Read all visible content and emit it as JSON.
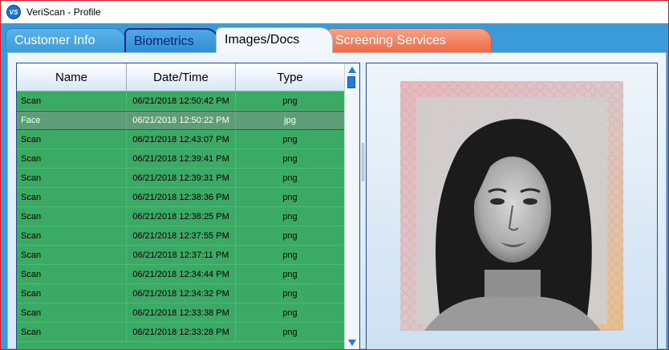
{
  "window": {
    "title": "VeriScan - Profile",
    "icon_text": "VS",
    "accent_border": "#e81123"
  },
  "tabs": [
    {
      "label": "Customer Info",
      "color": "#5ab2ea"
    },
    {
      "label": "Biometrics",
      "color": "#2f8fd3"
    },
    {
      "label": "Images/Docs",
      "color": "#f4f8fc",
      "selected": true
    },
    {
      "label": "Screening Services",
      "color": "#ee6a45"
    }
  ],
  "grid": {
    "columns": [
      "Name",
      "Date/Time",
      "Type"
    ],
    "row_color": "#3aaa64",
    "selected_index": 1,
    "rows": [
      {
        "name": "Scan",
        "datetime": "06/21/2018 12:50:42 PM",
        "type": "png"
      },
      {
        "name": "Face",
        "datetime": "06/21/2018 12:50:22 PM",
        "type": "jpg"
      },
      {
        "name": "Scan",
        "datetime": "06/21/2018 12:43:07 PM",
        "type": "png"
      },
      {
        "name": "Scan",
        "datetime": "06/21/2018 12:39:41 PM",
        "type": "png"
      },
      {
        "name": "Scan",
        "datetime": "06/21/2018 12:39:31 PM",
        "type": "png"
      },
      {
        "name": "Scan",
        "datetime": "06/21/2018 12:38:36 PM",
        "type": "png"
      },
      {
        "name": "Scan",
        "datetime": "06/21/2018 12:38:25 PM",
        "type": "png"
      },
      {
        "name": "Scan",
        "datetime": "06/21/2018 12:37:55 PM",
        "type": "png"
      },
      {
        "name": "Scan",
        "datetime": "06/21/2018 12:37:11 PM",
        "type": "png"
      },
      {
        "name": "Scan",
        "datetime": "06/21/2018 12:34:44 PM",
        "type": "png"
      },
      {
        "name": "Scan",
        "datetime": "06/21/2018 12:34:32 PM",
        "type": "png"
      },
      {
        "name": "Scan",
        "datetime": "06/21/2018 12:33:38 PM",
        "type": "png"
      },
      {
        "name": "Scan",
        "datetime": "06/21/2018 12:33:28 PM",
        "type": "png"
      }
    ]
  },
  "preview": {
    "icon": "face-photo"
  }
}
